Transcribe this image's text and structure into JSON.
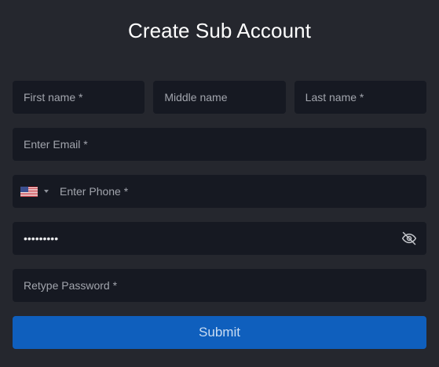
{
  "form": {
    "title": "Create Sub Account",
    "first_name": {
      "placeholder": "First name *",
      "value": ""
    },
    "middle_name": {
      "placeholder": "Middle name",
      "value": ""
    },
    "last_name": {
      "placeholder": "Last name *",
      "value": ""
    },
    "email": {
      "placeholder": "Enter Email *",
      "value": ""
    },
    "phone": {
      "placeholder": "Enter Phone *",
      "value": "",
      "country_icon": "us-flag-icon"
    },
    "password": {
      "value": "123456789",
      "toggle_icon": "eye-off-icon"
    },
    "retype_password": {
      "placeholder": "Retype Password *",
      "value": ""
    },
    "submit_label": "Submit"
  },
  "colors": {
    "background": "#25272e",
    "field_background": "#161922",
    "submit_background": "#0f5fbd",
    "submit_text": "#c9dcf2",
    "placeholder": "#a2a5ad"
  }
}
